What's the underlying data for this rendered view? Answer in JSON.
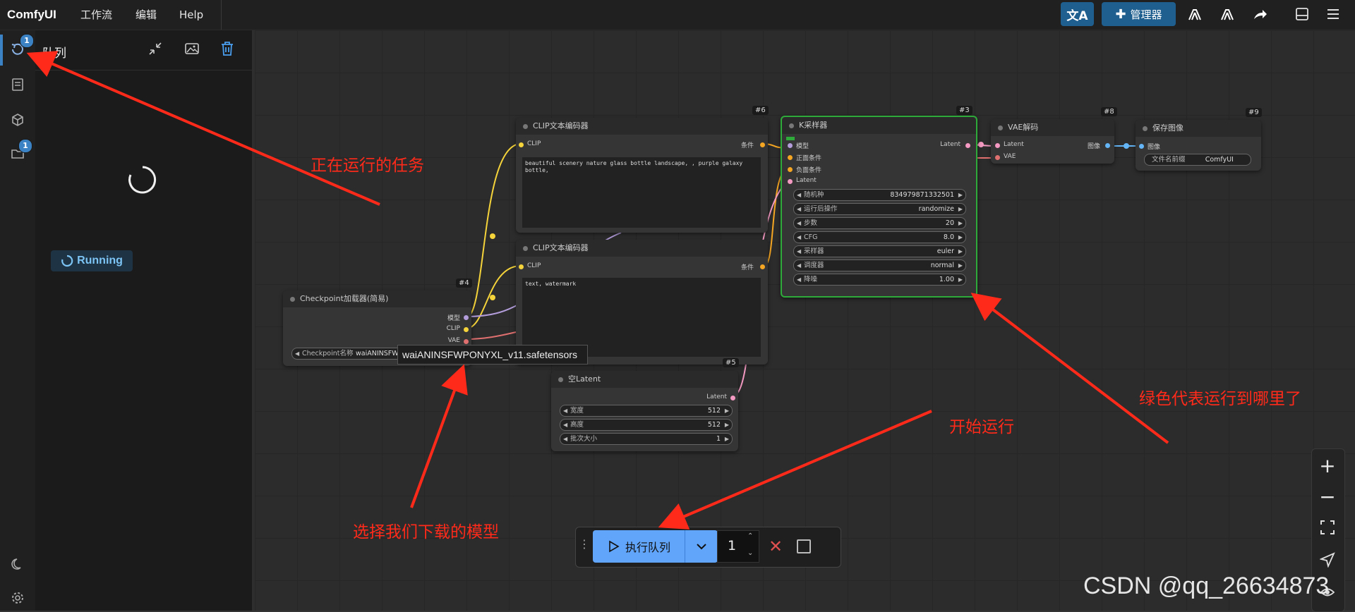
{
  "app": {
    "logo": "ComfyUI"
  },
  "menu": {
    "workflow": "工作流",
    "edit": "编辑",
    "help": "Help"
  },
  "toolbar": {
    "manager_label": "管理器"
  },
  "sidebar": {
    "queue_badge": "1",
    "models_badge": "1"
  },
  "queue_panel": {
    "title": "队列",
    "status": "Running"
  },
  "nodes": {
    "clip_top": {
      "id": "#6",
      "title": "CLIP文本编码器",
      "in_clip": "CLIP",
      "out_cond": "条件",
      "text": "beautiful scenery nature glass bottle landscape, , purple galaxy bottle,"
    },
    "clip_bottom": {
      "title": "CLIP文本编码器",
      "in_clip": "CLIP",
      "out_cond": "条件",
      "text": "text, watermark"
    },
    "ksampler": {
      "id": "#3",
      "title": "K采样器",
      "in_model": "模型",
      "in_pos": "正面条件",
      "in_neg": "负面条件",
      "in_latent": "Latent",
      "out_latent": "Latent",
      "widgets": [
        {
          "label": "随机种",
          "value": "834979871332501"
        },
        {
          "label": "运行后操作",
          "value": "randomize"
        },
        {
          "label": "步数",
          "value": "20"
        },
        {
          "label": "CFG",
          "value": "8.0"
        },
        {
          "label": "采样器",
          "value": "euler"
        },
        {
          "label": "调度器",
          "value": "normal"
        },
        {
          "label": "降噪",
          "value": "1.00"
        }
      ]
    },
    "vae": {
      "id": "#8",
      "title": "VAE解码",
      "in_latent": "Latent",
      "in_vae": "VAE",
      "out_image": "图像"
    },
    "save": {
      "id": "#9",
      "title": "保存图像",
      "in_image": "图像",
      "prefix_label": "文件名前缀",
      "prefix_value": "ComfyUI"
    },
    "ckpt": {
      "id": "#4",
      "title": "Checkpoint加载器(简易)",
      "out_model": "模型",
      "out_clip": "CLIP",
      "out_vae": "VAE",
      "ckpt_label": "Checkpoint名称",
      "ckpt_value": "waiANINSFW",
      "tooltip": "waiANINSFWPONYXL_v11.safetensors"
    },
    "latent": {
      "id": "#5",
      "title": "空Latent",
      "out_latent": "Latent",
      "widgets": [
        {
          "label": "宽度",
          "value": "512"
        },
        {
          "label": "高度",
          "value": "512"
        },
        {
          "label": "批次大小",
          "value": "1"
        }
      ]
    }
  },
  "run_bar": {
    "run_label": "执行队列",
    "count": "1"
  },
  "annotations": {
    "running_task": "正在运行的任务",
    "select_model": "选择我们下载的模型",
    "start_run": "开始运行",
    "green_progress": "绿色代表运行到哪里了"
  },
  "watermark": "CSDN @qq_26634873"
}
